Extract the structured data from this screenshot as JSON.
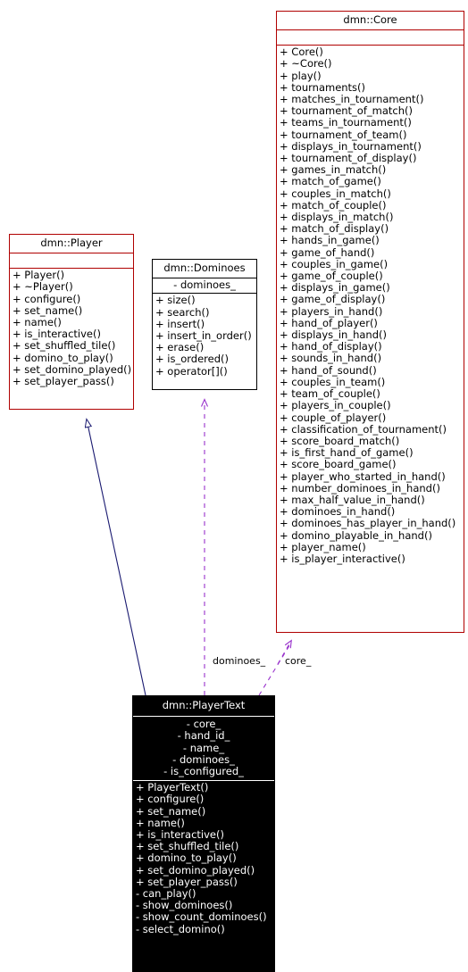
{
  "diagram": {
    "type": "uml-class-collaboration-diagram",
    "colors": {
      "class_border_red": "#b00000",
      "class_border_black": "#000000",
      "highlight_fill": "#000000",
      "highlight_text": "#ffffff",
      "inheritance_edge": "#191970",
      "usage_edge": "#9932cc"
    },
    "nodes": [
      {
        "id": "core",
        "title": "dmn::Core",
        "attributes": [],
        "operations": [
          "+ Core()",
          "+ ~Core()",
          "+ play()",
          "+ tournaments()",
          "+ matches_in_tournament()",
          "+ tournament_of_match()",
          "+ teams_in_tournament()",
          "+ tournament_of_team()",
          "+ displays_in_tournament()",
          "+ tournament_of_display()",
          "+ games_in_match()",
          "+ match_of_game()",
          "+ couples_in_match()",
          "+ match_of_couple()",
          "+ displays_in_match()",
          "+ match_of_display()",
          "+ hands_in_game()",
          "+ game_of_hand()",
          "+ couples_in_game()",
          "+ game_of_couple()",
          "+ displays_in_game()",
          "+ game_of_display()",
          "+ players_in_hand()",
          "+ hand_of_player()",
          "+ displays_in_hand()",
          "+ hand_of_display()",
          "+ sounds_in_hand()",
          "+ hand_of_sound()",
          "+ couples_in_team()",
          "+ team_of_couple()",
          "+ players_in_couple()",
          "+ couple_of_player()",
          "+ classification_of_tournament()",
          "+ score_board_match()",
          "+ is_first_hand_of_game()",
          "+ score_board_game()",
          "+ player_who_started_in_hand()",
          "+ number_dominoes_in_hand()",
          "+ max_half_value_in_hand()",
          "+ dominoes_in_hand()",
          "+ dominoes_has_player_in_hand()",
          "+ domino_playable_in_hand()",
          "+ player_name()",
          "+ is_player_interactive()"
        ]
      },
      {
        "id": "player",
        "title": "dmn::Player",
        "attributes": [],
        "operations": [
          "+ Player()",
          "+ ~Player()",
          "+ configure()",
          "+ set_name()",
          "+ name()",
          "+ is_interactive()",
          "+ set_shuffled_tile()",
          "+ domino_to_play()",
          "+ set_domino_played()",
          "+ set_player_pass()"
        ]
      },
      {
        "id": "dominoes",
        "title": "dmn::Dominoes",
        "attributes": [
          "- dominoes_"
        ],
        "operations": [
          "+ size()",
          "+ search()",
          "+ insert()",
          "+ insert_in_order()",
          "+ erase()",
          "+ is_ordered()",
          "+ operator[]()"
        ]
      },
      {
        "id": "playertext",
        "title": "dmn::PlayerText",
        "attributes": [
          "- core_",
          "- hand_id_",
          "- name_",
          "- dominoes_",
          "- is_configured_"
        ],
        "operations": [
          "+ PlayerText()",
          "+ configure()",
          "+ set_name()",
          "+ name()",
          "+ is_interactive()",
          "+ set_shuffled_tile()",
          "+ domino_to_play()",
          "+ set_domino_played()",
          "+ set_player_pass()",
          "- can_play()",
          "- show_dominoes()",
          "- show_count_dominoes()",
          "- select_domino()"
        ]
      }
    ],
    "edges": [
      {
        "id": "inheritance-playertext-player",
        "from": "playertext",
        "to": "player",
        "kind": "inheritance",
        "label": ""
      },
      {
        "id": "usage-playertext-dominoes",
        "from": "playertext",
        "to": "dominoes",
        "kind": "usage",
        "label": "dominoes_"
      },
      {
        "id": "usage-playertext-core",
        "from": "playertext",
        "to": "core",
        "kind": "usage",
        "label": "core_"
      }
    ]
  }
}
